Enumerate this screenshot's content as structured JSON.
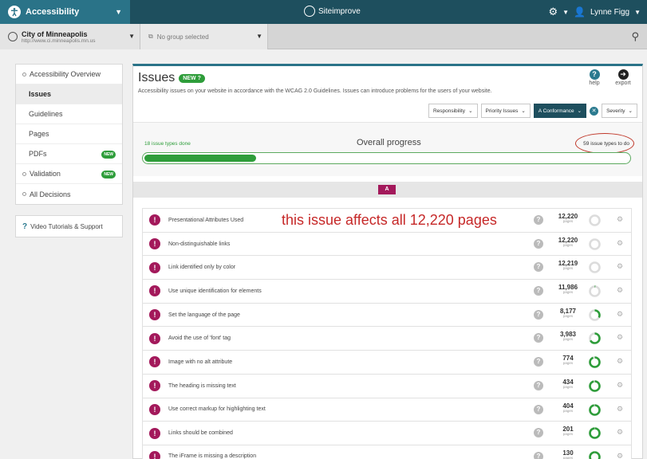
{
  "topbar": {
    "app_name": "Accessibility",
    "brand": "Siteimprove",
    "user_name": "Lynne Figg"
  },
  "site": {
    "name": "City of Minneapolis",
    "url": "http://www.ci.minneapolis.mn.us",
    "group_placeholder": "No group selected"
  },
  "sidebar": {
    "items": [
      {
        "label": "Accessibility Overview"
      },
      {
        "label": "Issues"
      },
      {
        "label": "Guidelines"
      },
      {
        "label": "Pages"
      },
      {
        "label": "PDFs",
        "badge": "NEW"
      },
      {
        "label": "Validation",
        "badge": "NEW"
      },
      {
        "label": "All Decisions"
      }
    ],
    "support_label": "Video Tutorials & Support"
  },
  "header": {
    "title": "Issues",
    "new_badge": "NEW",
    "subtitle": "Accessibility issues on your website in accordance with the WCAG 2.0 Guidelines. Issues can introduce problems for the users of your website.",
    "help_label": "help",
    "export_label": "export"
  },
  "filters": [
    {
      "label": "Responsibility",
      "active": false
    },
    {
      "label": "Priority Issues",
      "active": false
    },
    {
      "label": "A Conformance",
      "active": true
    },
    {
      "label": "Severity",
      "active": false
    }
  ],
  "progress": {
    "title": "Overall progress",
    "done_label": "18 issue types done",
    "todo_label": "59 issue types to do",
    "fraction": 0.23
  },
  "section_label": "A",
  "annotation": "this issue affects all 12,220 pages",
  "pages_unit": "pages",
  "issues": [
    {
      "name": "Presentational Attributes Used",
      "pages": "12,220",
      "fixed": 0.0
    },
    {
      "name": "Non-distinguishable links",
      "pages": "12,220",
      "fixed": 0.0
    },
    {
      "name": "Link identified only by color",
      "pages": "12,219",
      "fixed": 0.0
    },
    {
      "name": "Use unique identification for elements",
      "pages": "11,986",
      "fixed": 0.02
    },
    {
      "name": "Set the language of the page",
      "pages": "8,177",
      "fixed": 0.33
    },
    {
      "name": "Avoid the use of 'font' tag",
      "pages": "3,983",
      "fixed": 0.67
    },
    {
      "name": "Image with no alt attribute",
      "pages": "774",
      "fixed": 0.94
    },
    {
      "name": "The heading is missing text",
      "pages": "434",
      "fixed": 0.96
    },
    {
      "name": "Use correct markup for highlighting text",
      "pages": "404",
      "fixed": 0.97
    },
    {
      "name": "Links should be combined",
      "pages": "201",
      "fixed": 0.98
    },
    {
      "name": "The iFrame is missing a description",
      "pages": "130",
      "fixed": 0.99
    }
  ],
  "colors": {
    "brand_dark": "#1e4f5e",
    "brand": "#2a7388",
    "success": "#2e9d3a",
    "error": "#a3195b",
    "annotation": "#c62828"
  }
}
